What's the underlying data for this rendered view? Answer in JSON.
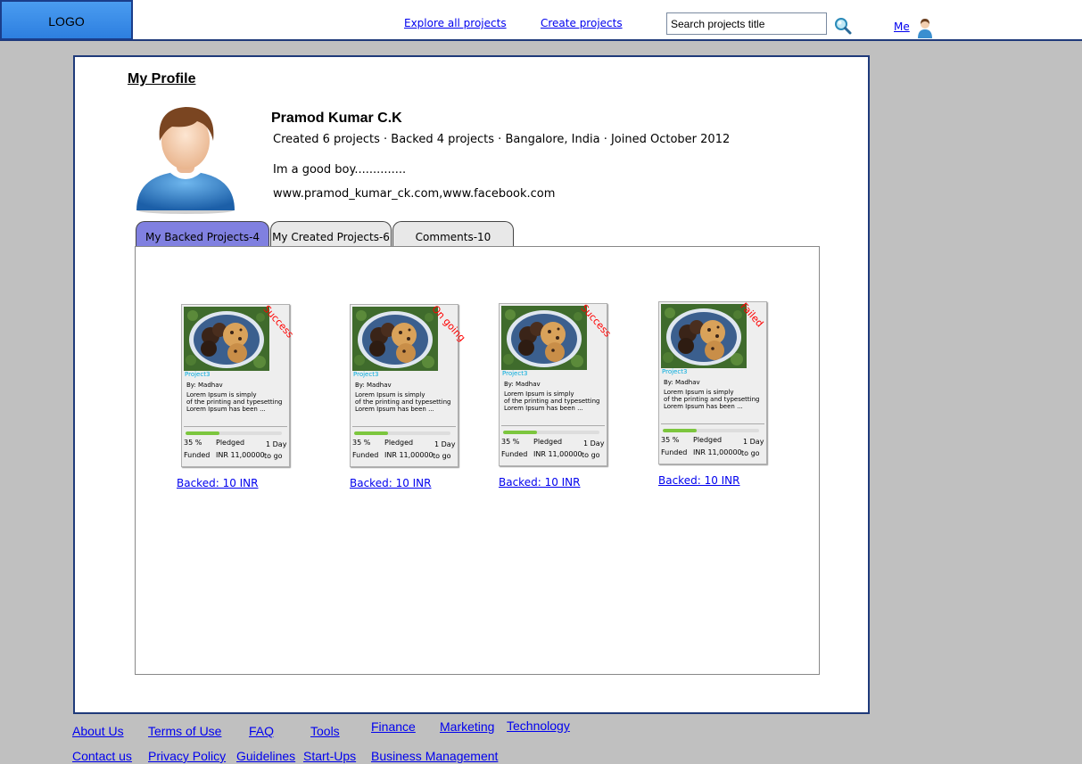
{
  "header": {
    "logo": "LOGO",
    "nav": {
      "explore": "Explore all projects",
      "create": "Create projects"
    },
    "search_placeholder": "Search projects title",
    "me_label": "Me"
  },
  "profile": {
    "title": "My Profile",
    "name": "Pramod Kumar C.K",
    "stats": "Created 6 projects · Backed 4 projects · Bangalore, India · Joined October 2012",
    "bio": "Im a good boy..............",
    "links": "www.pramod_kumar_ck.com,www.facebook.com"
  },
  "tabs": [
    {
      "label": "My Backed Projects-4",
      "active": true
    },
    {
      "label": "My Created Projects-6",
      "active": false
    },
    {
      "label": "Comments-10",
      "active": false
    }
  ],
  "cards": [
    {
      "status": "Success",
      "title": "Project3",
      "by": "By: Madhav",
      "desc": [
        "Lorem Ipsum is simply",
        "of the printing and typesetting",
        "Lorem Ipsum has been ..."
      ],
      "progress": 0.35,
      "funded_pct": "35 %",
      "funded_label": "Funded",
      "pledged_label": "Pledged",
      "pledged_value": "INR 11,00000",
      "days_value": "1 Day",
      "days_label": "to go",
      "backed": "Backed: 10 INR"
    },
    {
      "status": "On going",
      "title": "Project3",
      "by": "By: Madhav",
      "desc": [
        "Lorem Ipsum is simply",
        "of the printing and typesetting",
        "Lorem Ipsum has been ..."
      ],
      "progress": 0.35,
      "funded_pct": "35 %",
      "funded_label": "Funded",
      "pledged_label": "Pledged",
      "pledged_value": "INR 11,00000",
      "days_value": "1 Day",
      "days_label": "to go",
      "backed": "Backed: 10 INR"
    },
    {
      "status": "Success",
      "title": "Project3",
      "by": "By: Madhav",
      "desc": [
        "Lorem Ipsum is simply",
        "of the printing and typesetting",
        "Lorem Ipsum has been ..."
      ],
      "progress": 0.35,
      "funded_pct": "35 %",
      "funded_label": "Funded",
      "pledged_label": "Pledged",
      "pledged_value": "INR 11,00000",
      "days_value": "1 Day",
      "days_label": "to go",
      "backed": "Backed: 10 INR"
    },
    {
      "status": "Failed",
      "title": "Project3",
      "by": "By: Madhav",
      "desc": [
        "Lorem Ipsum is simply",
        "of the printing and typesetting",
        "Lorem Ipsum has been ..."
      ],
      "progress": 0.35,
      "funded_pct": "35 %",
      "funded_label": "Funded",
      "pledged_label": "Pledged",
      "pledged_value": "INR 11,00000",
      "days_value": "1 Day",
      "days_label": "to go",
      "backed": "Backed: 10 INR"
    }
  ],
  "footer": {
    "about": "About Us",
    "terms": "Terms of Use",
    "faq": "FAQ",
    "tools": "Tools",
    "finance": "Finance",
    "marketing": "Marketing",
    "technology": "Technology",
    "contact": "Contact us",
    "privacy": "Privacy Policy",
    "guidelines": "Guidelines",
    "startups": "Start-Ups",
    "business": "Business Management"
  },
  "colors": {
    "accent_tab": "#8080e0",
    "status_red": "#ff0000",
    "progress_green": "#7cc63e",
    "link_blue": "#0000ee",
    "border_navy": "#1f3a7a"
  },
  "icons": {
    "search": "magnifier-icon",
    "me": "user-icon"
  }
}
